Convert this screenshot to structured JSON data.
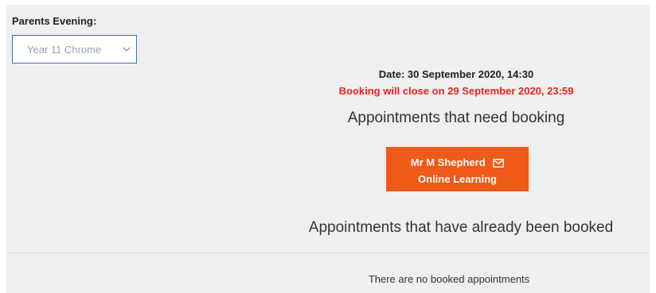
{
  "evening_label": "Parents Evening:",
  "select": {
    "value": "Year 11 Chrome"
  },
  "date_line": "Date: 30 September 2020, 14:30",
  "close_notice": "Booking will close on 29 September 2020, 23:59",
  "need_booking_heading": "Appointments that need booking",
  "appointment_button": {
    "teacher": "Mr M Shepherd",
    "subject": "Online Learning",
    "icon": "mail-icon"
  },
  "booked_heading": "Appointments that have already been booked",
  "no_booked_text": "There are no booked appointments",
  "colors": {
    "panel_bg": "#eeeff1",
    "accent_orange": "#ef5a18",
    "warning_red": "#e5261f",
    "select_border": "#4c6fa8"
  }
}
